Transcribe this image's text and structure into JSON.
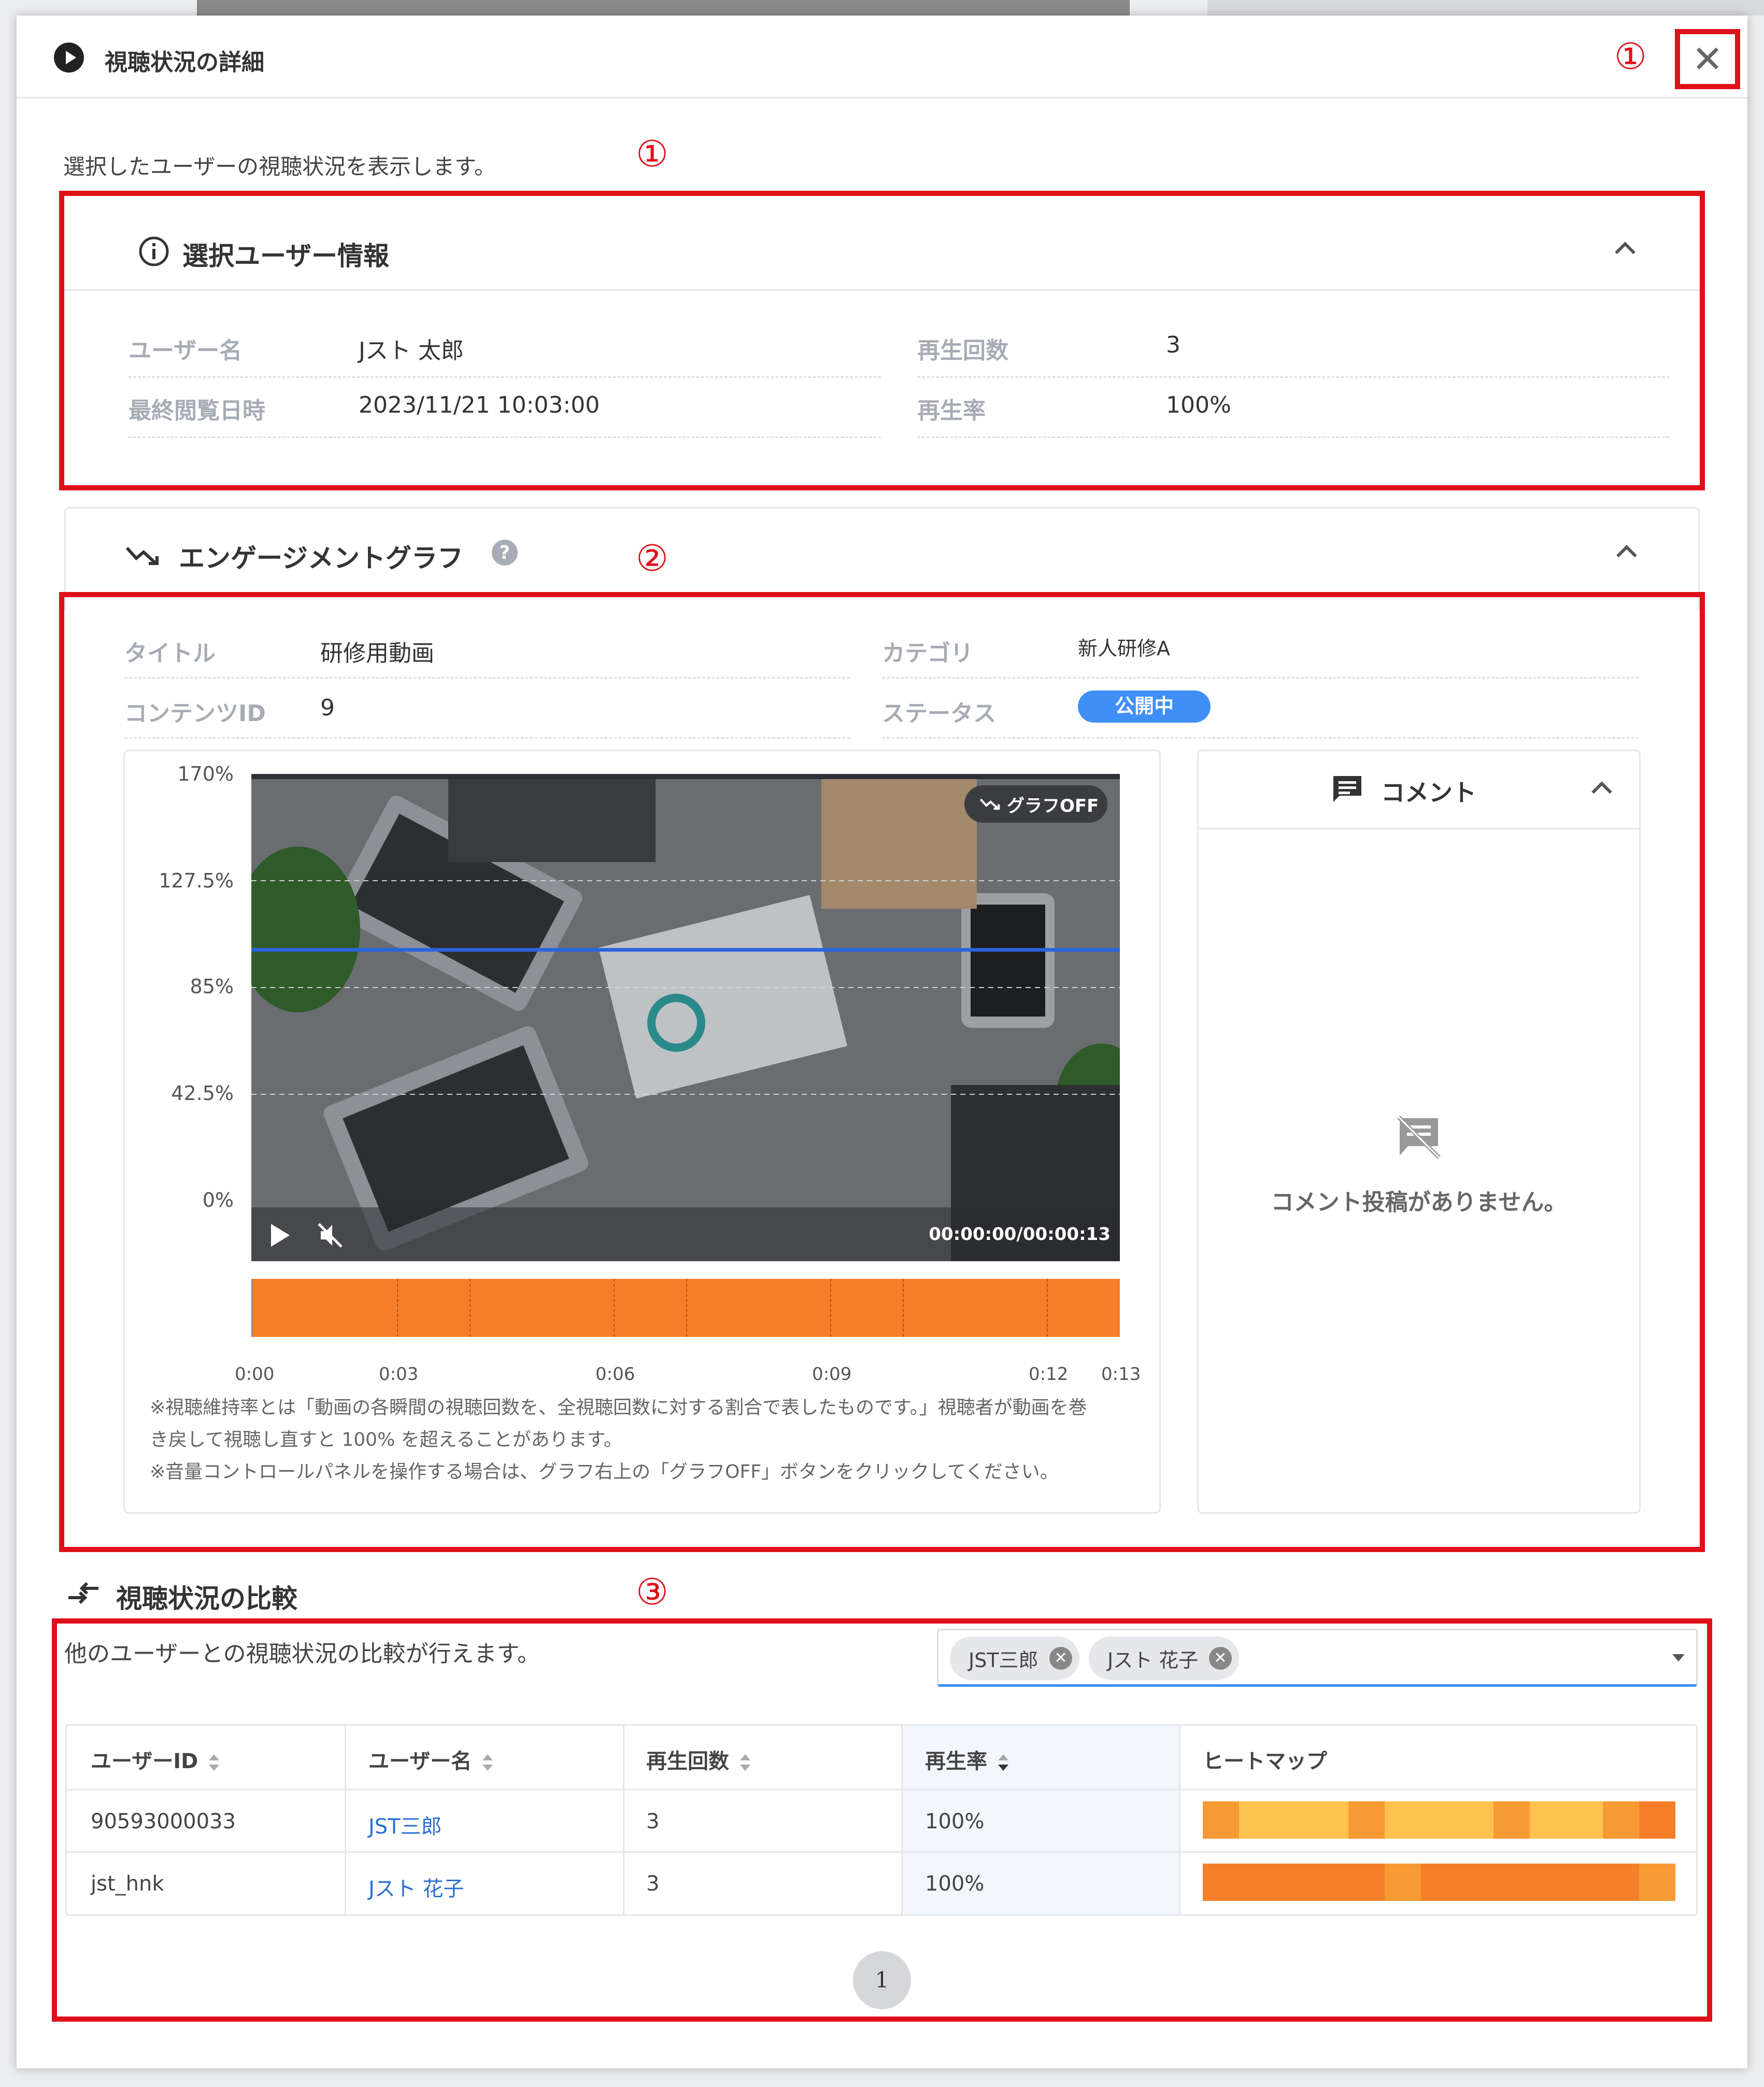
{
  "modal": {
    "title": "視聴状況の詳細",
    "close_label": "✕",
    "intro": "選択したユーザーの視聴状況を表示します。"
  },
  "annotations": [
    "①",
    "①",
    "②",
    "③"
  ],
  "user_info": {
    "title": "選択ユーザー情報",
    "fields": [
      {
        "label": "ユーザー名",
        "value": "Jスト 太郎"
      },
      {
        "label": "最終閲覧日時",
        "value": "2023/11/21 10:03:00"
      },
      {
        "label": "再生回数",
        "value": "3"
      },
      {
        "label": "再生率",
        "value": "100%"
      }
    ]
  },
  "engagement": {
    "title": "エンゲージメントグラフ",
    "fields": [
      {
        "label": "タイトル",
        "value": "研修用動画"
      },
      {
        "label": "コンテンツID",
        "value": "9"
      },
      {
        "label": "カテゴリ",
        "value": "新人研修A"
      },
      {
        "label": "ステータス",
        "value": "公開中"
      }
    ],
    "graph_off_label": "グラフOFF",
    "time_display": "00:00:00/00:00:13",
    "notes": [
      "※視聴維持率とは「動画の各瞬間の視聴回数を、全視聴回数に対する割合で表したものです。」視聴者が動画を巻",
      "き戻して視聴し直すと 100% を超えることがあります。",
      "※音量コントロールパネルを操作する場合は、グラフ右上の「グラフOFF」ボタンをクリックしてください。"
    ],
    "status_color": "#3f8ff7",
    "heat_color": "#f57f29"
  },
  "chart_data": {
    "type": "line",
    "y_ticks": [
      "170%",
      "127.5%",
      "85%",
      "42.5%",
      "0%"
    ],
    "x_ticks": [
      "0:00",
      "0:03",
      "0:06",
      "0:09",
      "0:12",
      "0:13"
    ],
    "ylim": [
      0,
      170
    ],
    "xlim": [
      0,
      13
    ],
    "series": [
      {
        "x": [
          0,
          3,
          6,
          9,
          12,
          13
        ],
        "values": [
          100,
          100,
          100,
          100,
          100,
          100
        ]
      }
    ]
  },
  "comments": {
    "title": "コメント",
    "empty_text": "コメント投稿がありません。"
  },
  "comparison": {
    "title": "視聴状況の比較",
    "description": "他のユーザーとの視聴状況の比較が行えます。",
    "selected_chips": [
      "JST三郎",
      "Jスト 花子"
    ],
    "columns": [
      "ユーザーID",
      "ユーザー名",
      "再生回数",
      "再生率",
      "ヒートマップ"
    ],
    "rows": [
      {
        "id": "90593000033",
        "name": "JST三郎",
        "plays": "3",
        "rate": "100%",
        "heatmap": [
          "#f79a33",
          "#ffc34d",
          "#ffc34d",
          "#ffc34d",
          "#f79a33",
          "#ffc34d",
          "#ffc34d",
          "#ffc34d",
          "#f79a33",
          "#ffc34d",
          "#ffc34d",
          "#f79a33",
          "#f57f29"
        ]
      },
      {
        "id": "jst_hnk",
        "name": "Jスト 花子",
        "plays": "3",
        "rate": "100%",
        "heatmap": [
          "#f57f29",
          "#f57f29",
          "#f57f29",
          "#f57f29",
          "#f57f29",
          "#f79a33",
          "#f57f29",
          "#f57f29",
          "#f57f29",
          "#f57f29",
          "#f57f29",
          "#f57f29",
          "#f79a33"
        ]
      }
    ],
    "page": "1"
  }
}
